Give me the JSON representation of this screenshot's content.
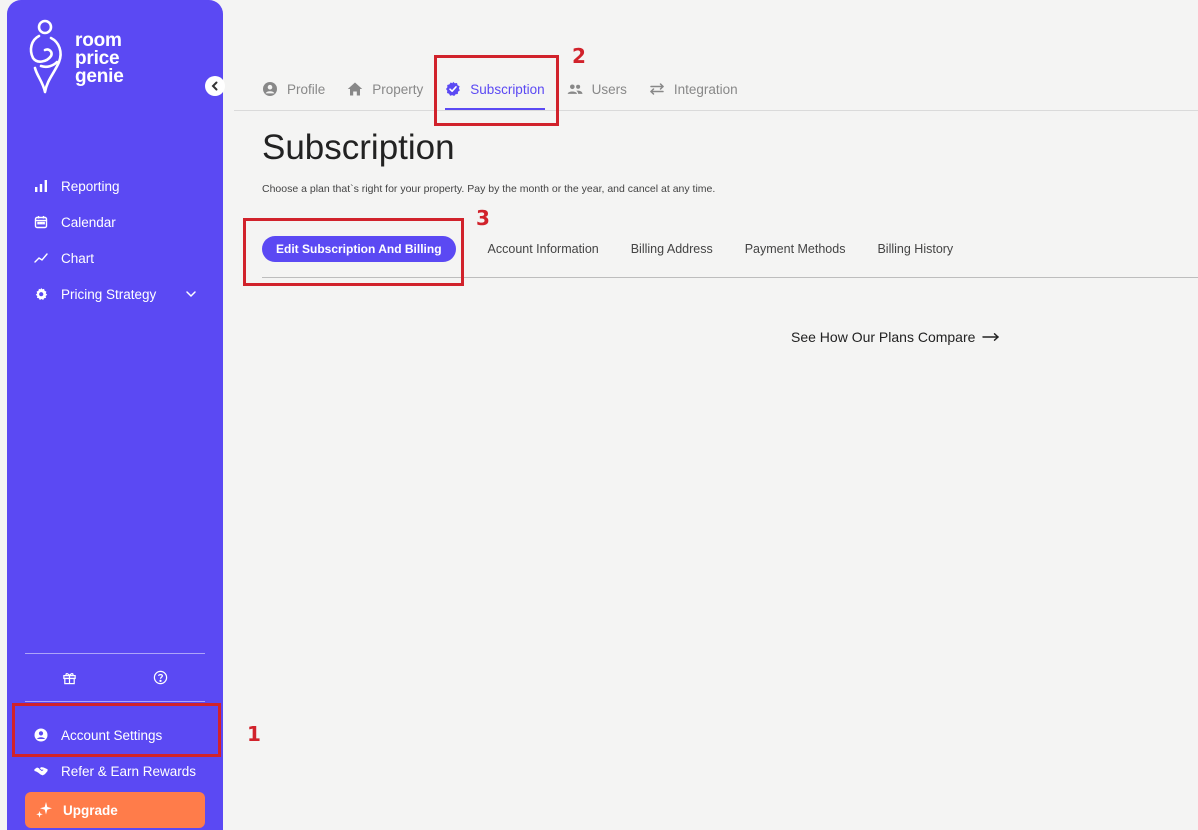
{
  "brand": {
    "logo_lines": [
      "room",
      "price",
      "genie"
    ]
  },
  "sidebar": {
    "items": [
      {
        "label": "Reporting",
        "icon": "bar-chart-icon"
      },
      {
        "label": "Calendar",
        "icon": "calendar-icon"
      },
      {
        "label": "Chart",
        "icon": "line-chart-icon"
      },
      {
        "label": "Pricing Strategy",
        "icon": "gear-icon"
      }
    ],
    "bottom_icons": [
      "gift-icon",
      "help-circle-icon"
    ],
    "account_settings": "Account Settings",
    "refer": "Refer & Earn Rewards",
    "upgrade": "Upgrade"
  },
  "tabs": [
    {
      "label": "Profile",
      "icon": "user-circle-icon"
    },
    {
      "label": "Property",
      "icon": "home-icon"
    },
    {
      "label": "Subscription",
      "icon": "verified-badge-icon",
      "active": true
    },
    {
      "label": "Users",
      "icon": "users-icon"
    },
    {
      "label": "Integration",
      "icon": "swap-arrows-icon"
    }
  ],
  "page": {
    "title": "Subscription",
    "subtitle": "Choose a plan that`s right for your property. Pay by the month or the year, and cancel at any time."
  },
  "subtabs": {
    "active": "Edit Subscription And Billing",
    "items": [
      "Account Information",
      "Billing Address",
      "Payment Methods",
      "Billing History"
    ]
  },
  "compare_link": "See How Our Plans Compare",
  "annotations": [
    "1",
    "2",
    "3"
  ],
  "colors": {
    "brand": "#5b49f3",
    "upgrade": "#ff7c4a",
    "annotation": "#d1222b",
    "background": "#f4f4f3"
  }
}
